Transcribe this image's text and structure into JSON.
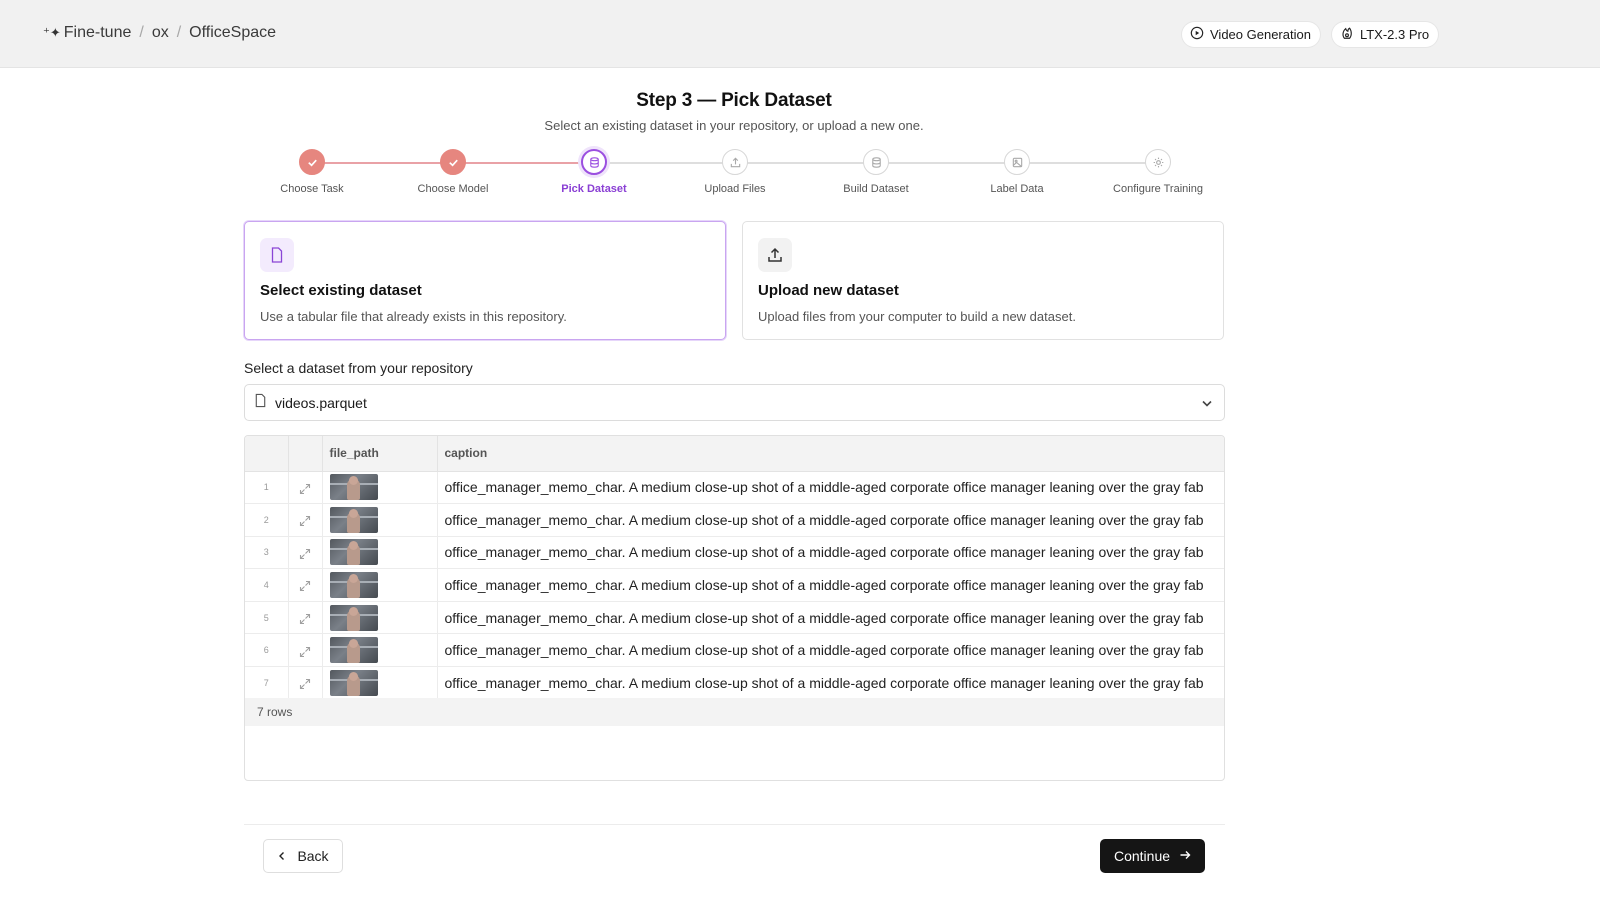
{
  "breadcrumb": {
    "root": "Fine-tune",
    "org": "ox",
    "repo": "OfficeSpace",
    "separator": "/"
  },
  "chips": {
    "task": "Video Generation",
    "model": "LTX-2.3 Pro"
  },
  "page": {
    "title": "Step 3 — Pick Dataset",
    "subtitle": "Select an existing dataset in your repository, or upload a new one."
  },
  "steps": [
    {
      "label": "Choose Task",
      "state": "done",
      "icon": "check-icon"
    },
    {
      "label": "Choose Model",
      "state": "done",
      "icon": "check-icon"
    },
    {
      "label": "Pick Dataset",
      "state": "active",
      "icon": "database-icon"
    },
    {
      "label": "Upload Files",
      "state": "pending",
      "icon": "upload-icon"
    },
    {
      "label": "Build Dataset",
      "state": "pending",
      "icon": "database-icon"
    },
    {
      "label": "Label Data",
      "state": "pending",
      "icon": "image-icon"
    },
    {
      "label": "Configure Training",
      "state": "pending",
      "icon": "gear-icon"
    }
  ],
  "options": {
    "existing": {
      "title": "Select existing dataset",
      "description": "Use a tabular file that already exists in this repository.",
      "icon": "file-icon",
      "selected": true
    },
    "upload": {
      "title": "Upload new dataset",
      "description": "Upload files from your computer to build a new dataset.",
      "icon": "upload-icon",
      "selected": false
    }
  },
  "dataset_select": {
    "label": "Select a dataset from your repository",
    "value": "videos.parquet"
  },
  "table": {
    "columns": [
      "",
      "",
      "file_path",
      "caption"
    ],
    "rows": [
      {
        "index": "1",
        "caption": "office_manager_memo_char. A medium close-up shot of a middle-aged corporate office manager leaning over the gray fab"
      },
      {
        "index": "2",
        "caption": "office_manager_memo_char. A medium close-up shot of a middle-aged corporate office manager leaning over the gray fab"
      },
      {
        "index": "3",
        "caption": "office_manager_memo_char. A medium close-up shot of a middle-aged corporate office manager leaning over the gray fab"
      },
      {
        "index": "4",
        "caption": "office_manager_memo_char. A medium close-up shot of a middle-aged corporate office manager leaning over the gray fab"
      },
      {
        "index": "5",
        "caption": "office_manager_memo_char. A medium close-up shot of a middle-aged corporate office manager leaning over the gray fab"
      },
      {
        "index": "6",
        "caption": "office_manager_memo_char. A medium close-up shot of a middle-aged corporate office manager leaning over the gray fab"
      },
      {
        "index": "7",
        "caption": "office_manager_memo_char. A medium close-up shot of a middle-aged corporate office manager leaning over the gray fab"
      }
    ],
    "row_count": "7 rows"
  },
  "actions": {
    "back": "Back",
    "continue": "Continue"
  },
  "colors": {
    "accent": "#9b4fe0",
    "done": "#e6867f",
    "primary_button": "#151515"
  }
}
